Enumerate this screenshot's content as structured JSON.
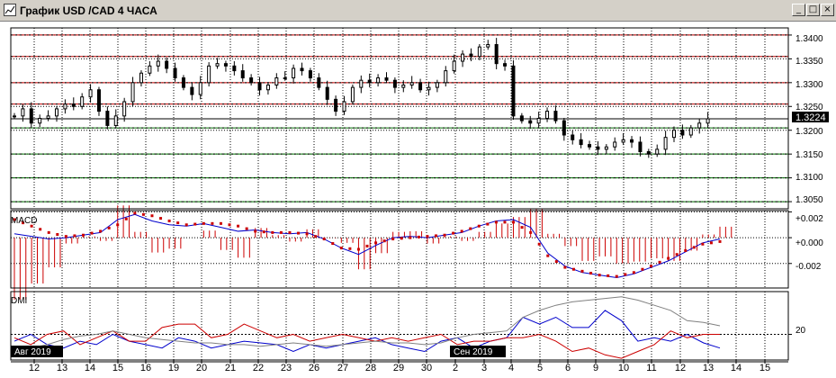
{
  "window": {
    "title": "График USD /CAD  4 ЧАСА",
    "buttons": [
      "_",
      "□",
      "×"
    ]
  },
  "price_panel": {
    "current_price": "1.3224",
    "y_ticks": [
      "1.3400",
      "1.3350",
      "1.3300",
      "1.3250",
      "1.3200",
      "1.3150",
      "1.3100",
      "1.3050"
    ]
  },
  "macd_panel": {
    "label": "MACD",
    "y_ticks": [
      "+0.002",
      "+0.000",
      "-0.002"
    ]
  },
  "dmi_panel": {
    "label": "DMI",
    "y_ticks": [
      "20"
    ]
  },
  "x_axis": {
    "days": [
      "12",
      "13",
      "14",
      "15",
      "16",
      "19",
      "20",
      "21",
      "22",
      "23",
      "26",
      "27",
      "28",
      "29",
      "30",
      "2",
      "3",
      "4",
      "5",
      "6",
      "9",
      "10",
      "11",
      "12",
      "13",
      "14",
      "15"
    ],
    "month_labels": [
      "Авг 2019",
      "Сен 2019"
    ]
  },
  "colors": {
    "background": "#ffffff",
    "grid": "#000000",
    "candle": "#000000",
    "resistance": "#c00000",
    "support": "#007000",
    "macd_line": "#0000cc",
    "macd_signal": "#cc0000",
    "dmi_plus": "#0000cc",
    "dmi_minus": "#cc0000",
    "adx": "#808080"
  },
  "chart_data": [
    {
      "type": "candlestick",
      "title": "График USD /CAD  4 ЧАСА",
      "xlabel": "",
      "ylabel": "",
      "ylim": [
        1.3035,
        1.3415
      ],
      "grid": true,
      "last_price": 1.3224,
      "levels": {
        "resistance": [
          1.34,
          1.3355,
          1.33,
          1.3255
        ],
        "support": [
          1.3205,
          1.315,
          1.31,
          1.305
        ],
        "current": 1.3224
      },
      "series": [
        {
          "values": [
            1.323,
            1.3245,
            1.3215,
            1.3225,
            1.323,
            1.3245,
            1.3255,
            1.325,
            1.327,
            1.3285,
            1.324,
            1.321,
            1.323,
            1.326,
            1.33,
            1.332,
            1.3335,
            1.3345,
            1.333,
            1.331,
            1.329,
            1.3275,
            1.33,
            1.3335,
            1.334,
            1.3335,
            1.3325,
            1.331,
            1.33,
            1.3285,
            1.3295,
            1.331,
            1.331,
            1.333,
            1.3325,
            1.331,
            1.329,
            1.3265,
            1.324,
            1.326,
            1.329,
            1.3305,
            1.33,
            1.331,
            1.3305,
            1.329,
            1.3295,
            1.33,
            1.3285,
            1.329,
            1.33,
            1.3325,
            1.3345,
            1.336,
            1.3355,
            1.3375,
            1.338,
            1.334,
            1.3335,
            1.323,
            1.322,
            1.3215,
            1.3225,
            1.324,
            1.322,
            1.319,
            1.318,
            1.317,
            1.3165,
            1.316,
            1.3165,
            1.3175,
            1.318,
            1.3175,
            1.3155,
            1.315,
            1.316,
            1.3185,
            1.32,
            1.319,
            1.3205,
            1.3215,
            1.3224
          ]
        }
      ]
    },
    {
      "type": "line",
      "title": "MACD",
      "ylim": [
        -0.0039,
        0.0021
      ],
      "series": [
        {
          "values": [
            0.0003,
            0.0001,
            -0.0001,
            0.0,
            0.0002,
            0.0004,
            0.0014,
            0.0018,
            0.0013,
            0.001,
            0.0009,
            0.0011,
            0.0008,
            0.0005,
            0.0006,
            0.0004,
            0.0003,
            0.0004,
            -0.0001,
            -0.0008,
            -0.0013,
            -0.0006,
            0.0,
            0.0001,
            0.0,
            0.0002,
            0.0004,
            0.0009,
            0.0013,
            0.0014,
            0.0008,
            -0.0012,
            -0.0022,
            -0.0027,
            -0.0029,
            -0.0031,
            -0.0028,
            -0.0023,
            -0.0018,
            -0.0011,
            -0.0004,
            -0.0001
          ]
        },
        {
          "values": [
            0.0014,
            0.0009,
            0.0004,
            0.0001,
            0.0002,
            0.0005,
            0.001,
            0.0019,
            0.0017,
            0.0013,
            0.001,
            0.0011,
            0.0011,
            0.0009,
            0.0005,
            0.0004,
            0.0004,
            0.0003,
            -0.0001,
            -0.0008,
            -0.0009,
            -0.0004,
            -0.0001,
            0.0,
            0.0001,
            0.0002,
            0.0005,
            0.0009,
            0.0012,
            0.0012,
            0.0004,
            -0.0014,
            -0.0023,
            -0.0026,
            -0.0029,
            -0.003,
            -0.0027,
            -0.0022,
            -0.0016,
            -0.001,
            -0.0005,
            -0.0003
          ]
        }
      ]
    },
    {
      "type": "line",
      "title": "DMI",
      "ylim": [
        5,
        45
      ],
      "series": [
        {
          "values": [
            16,
            20,
            14,
            12,
            16,
            14,
            20,
            16,
            14,
            12,
            18,
            16,
            12,
            14,
            16,
            15,
            14,
            10,
            14,
            12,
            14,
            16,
            18,
            14,
            12,
            10,
            16,
            18,
            12,
            16,
            18,
            30,
            26,
            30,
            24,
            24,
            34,
            28,
            16,
            18,
            16,
            20,
            15,
            12
          ]
        },
        {
          "values": [
            18,
            14,
            20,
            22,
            14,
            18,
            22,
            16,
            16,
            24,
            26,
            26,
            18,
            20,
            26,
            22,
            18,
            20,
            16,
            18,
            20,
            18,
            16,
            18,
            16,
            18,
            20,
            14,
            16,
            16,
            18,
            18,
            20,
            16,
            10,
            12,
            8,
            6,
            10,
            14,
            22,
            18,
            20,
            20
          ]
        },
        {
          "values": [
            10,
            12,
            14,
            17,
            19,
            20,
            22,
            20,
            18,
            17,
            16,
            15,
            15,
            14,
            14,
            13,
            14,
            15,
            14,
            13,
            14,
            15,
            16,
            15,
            15,
            14,
            15,
            18,
            20,
            21,
            22,
            30,
            34,
            37,
            39,
            40,
            41,
            42,
            40,
            37,
            34,
            28,
            27,
            25
          ]
        }
      ]
    }
  ]
}
